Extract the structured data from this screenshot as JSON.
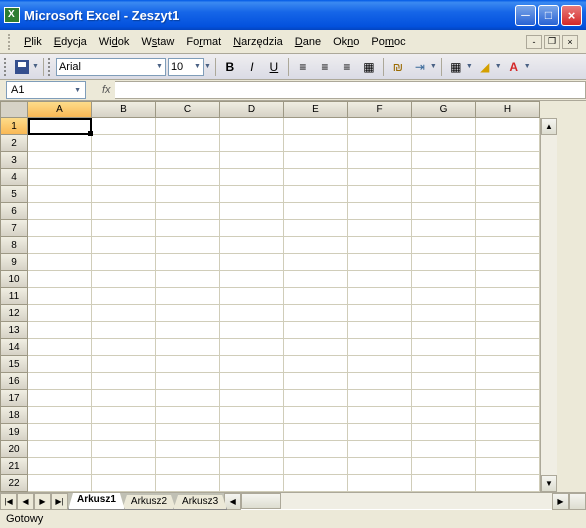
{
  "title": "Microsoft Excel - Zeszyt1",
  "menu": [
    "Plik",
    "Edycja",
    "Widok",
    "Wstaw",
    "Format",
    "Narzędzia",
    "Dane",
    "Okno",
    "Pomoc"
  ],
  "menu_underline_idx": [
    0,
    0,
    2,
    1,
    2,
    0,
    0,
    2,
    2
  ],
  "toolbar": {
    "font": "Arial",
    "size": "10"
  },
  "namebox": "A1",
  "formula": "",
  "columns": [
    "A",
    "B",
    "C",
    "D",
    "E",
    "F",
    "G",
    "H"
  ],
  "rows": [
    1,
    2,
    3,
    4,
    5,
    6,
    7,
    8,
    9,
    10,
    11,
    12,
    13,
    14,
    15,
    16,
    17,
    18,
    19,
    20,
    21,
    22
  ],
  "active_cell": {
    "col": "A",
    "row": 1
  },
  "sheets": [
    "Arkusz1",
    "Arkusz2",
    "Arkusz3"
  ],
  "active_sheet": 0,
  "status": "Gotowy"
}
